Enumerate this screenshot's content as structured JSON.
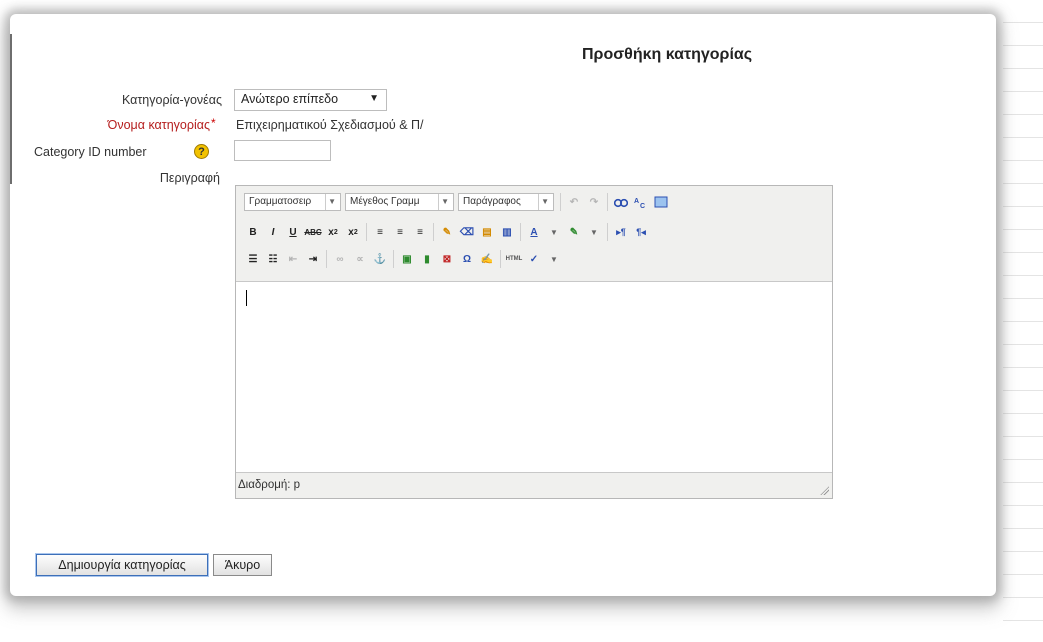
{
  "page_title": "Προσθήκη κατηγορίας",
  "form": {
    "parent_label": "Κατηγορία-γονέας",
    "parent_value": "Ανώτερο επίπεδο",
    "name_label": "Όνομα κατηγορίας",
    "required_mark": "*",
    "name_value": "Επιχειρηματικού Σχεδιασμού & Π/",
    "idnumber_label": "Category ID number",
    "idnumber_value": "",
    "help_glyph": "?",
    "description_label": "Περιγραφή"
  },
  "editor": {
    "font_family": "Γραμματοσειρ",
    "font_size": "Μέγεθος Γραμμ",
    "format": "Παράγραφος",
    "path_label": "Διαδρομή: p"
  },
  "buttons": {
    "create": "Δημιουργία κατηγορίας",
    "cancel": "Άκυρο"
  },
  "colors": {
    "required_label": "#b51e1e",
    "help_icon": "#f2c200",
    "primary_button_border": "#3d6fb8"
  }
}
